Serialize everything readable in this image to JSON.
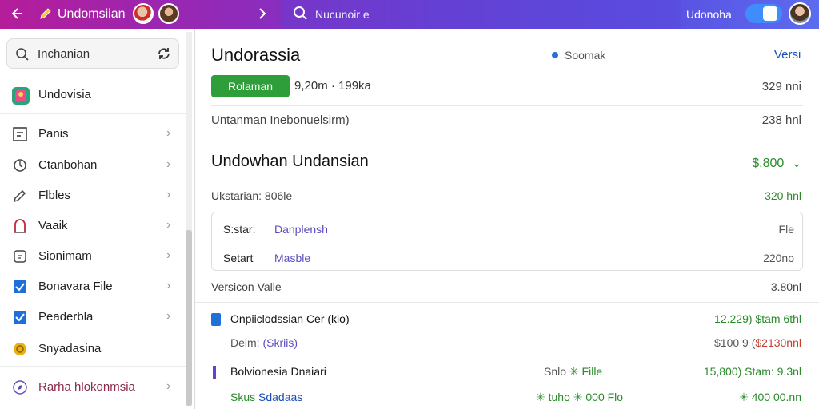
{
  "topbar": {
    "title": "Undomsiian",
    "search_text": "Nucunoir e",
    "user_name": "Udonoha",
    "back_icon": "arrow-left-icon",
    "chevron_icon": "chevron-right-icon"
  },
  "sidebar": {
    "search_value": "Inchanian",
    "items": [
      {
        "label": "Undovisia",
        "icon": "app-icon"
      },
      {
        "label": "Panis",
        "icon": "square-icon"
      },
      {
        "label": "Ctanbohan",
        "icon": "badge-icon"
      },
      {
        "label": "Flbles",
        "icon": "pencil-icon"
      },
      {
        "label": "Vaaik",
        "icon": "magnet-icon"
      },
      {
        "label": "Sionimam",
        "icon": "note-icon"
      },
      {
        "label": "Bonavara File",
        "icon": "checkbox-icon"
      },
      {
        "label": "Peaderbla",
        "icon": "checkbox-icon"
      },
      {
        "label": "Snyadasina",
        "icon": "coin-icon"
      },
      {
        "label": "Rarha hlokonmsia",
        "icon": "compass-icon"
      }
    ]
  },
  "main": {
    "title": "Undorassia",
    "status": "Soomak",
    "link": "Versi",
    "button": "Rolaman",
    "range": "9,20m · 199ka",
    "right1": "329 nni",
    "subtitle": "Untanman Inebonuelsirm)",
    "right2": "238 hnl",
    "section_title": "Undowhan Undansian",
    "section_value": "$.800",
    "info": "Ukstarian: 806le",
    "info_right": "320 hnl",
    "card": {
      "row1_key": "S:star:",
      "row1_val": "Danplensh",
      "row1_right": "Fle",
      "row2_key": "Setart",
      "row2_val": "Masble",
      "row2_right": "220no"
    },
    "version_label": "Versicon Valle",
    "version_right": "3.80nl",
    "rows": [
      {
        "title": "Onpiiclodssian Cer (kio)",
        "sub_label": "Deim:",
        "sub_value": "(Skriis)",
        "right_top": "12.229) $tam 6thl",
        "right_bottom_a": "$100 9 (",
        "right_bottom_b": "$2130nnl"
      },
      {
        "title": "Bolvionesia Dnaiari",
        "mid_a": "Snlo",
        "mid_b": "✳ Fille",
        "sub_label": "Skus",
        "sub_value": "Sdadaas",
        "mid2": "✳ tuho ✳ 000 Flo",
        "right_top": "15,800) Stam: 9.3nl",
        "right_bottom": "✳ 400 00.nn"
      }
    ]
  }
}
